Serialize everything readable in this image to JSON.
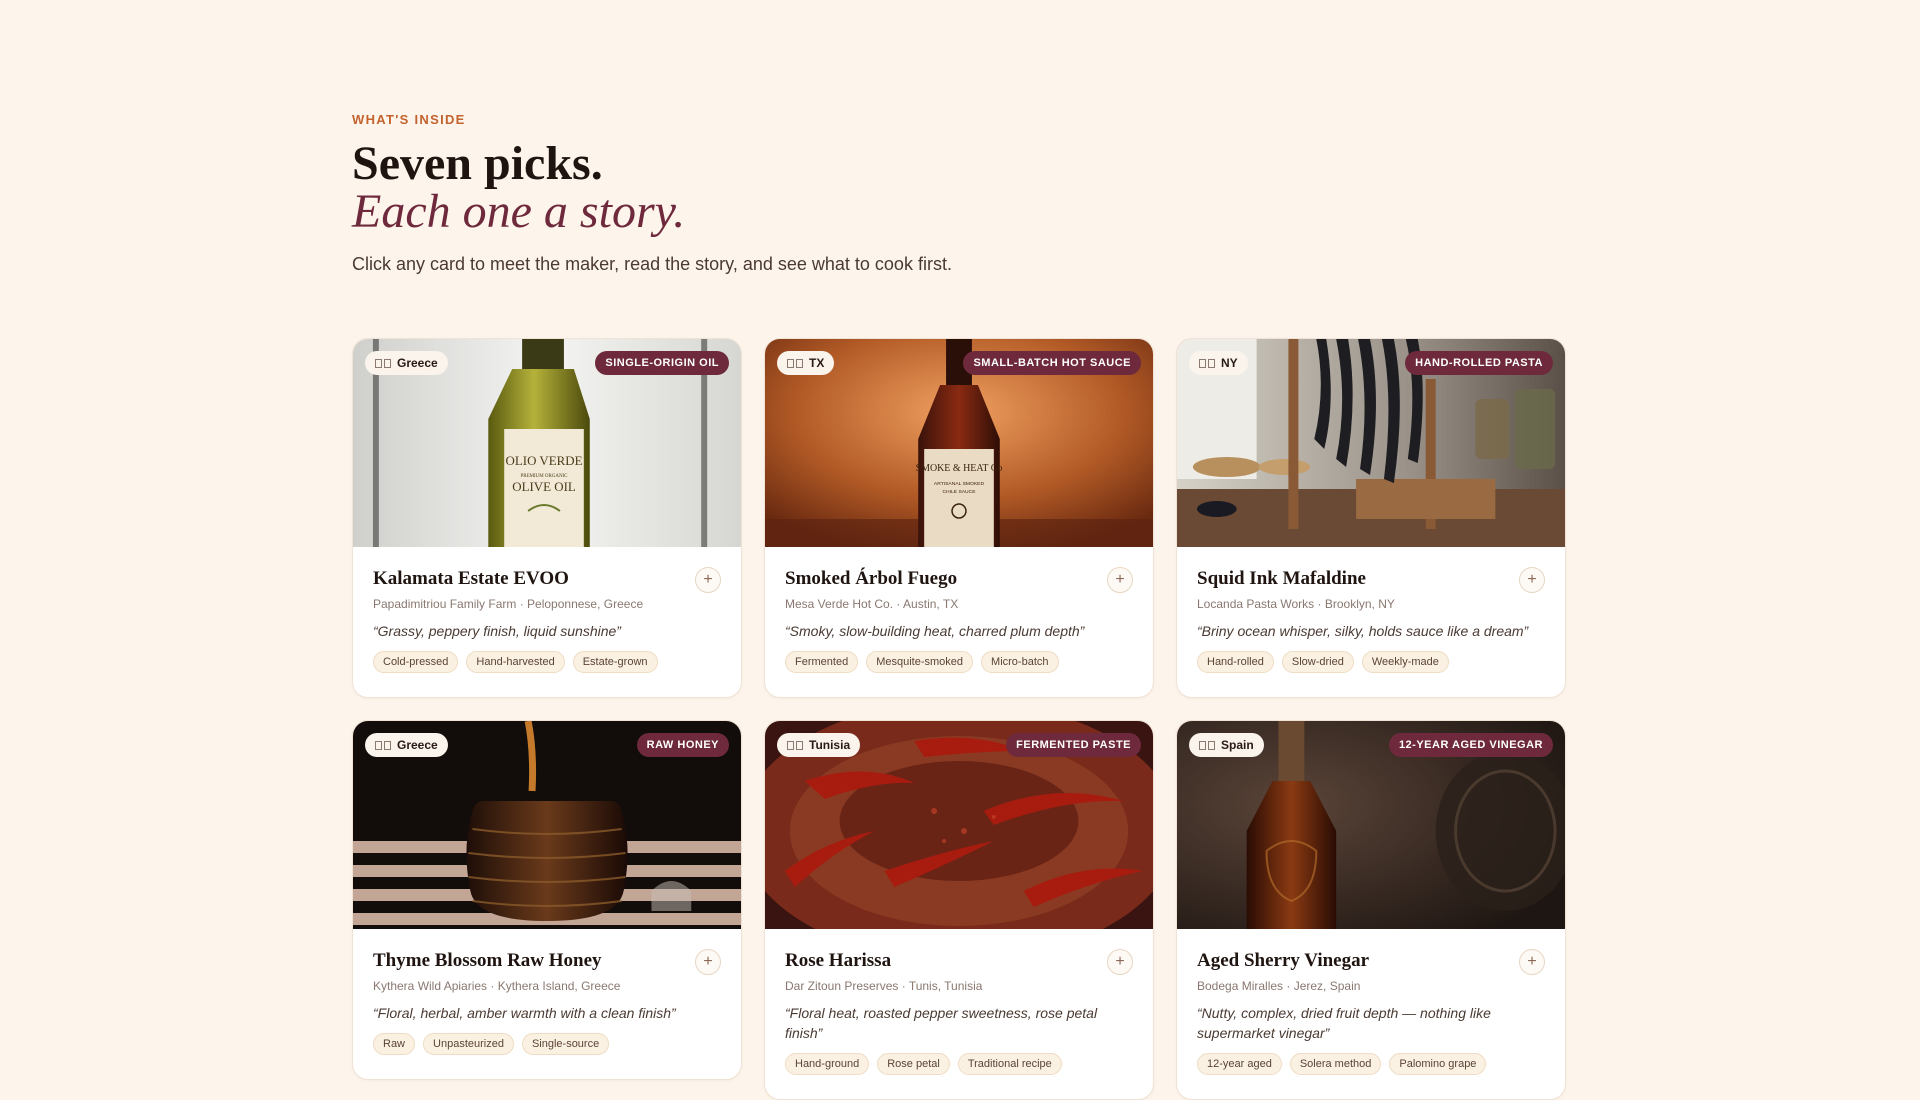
{
  "section": {
    "eyebrow": "WHAT'S INSIDE",
    "title_line1": "Seven picks.",
    "title_line2": "Each one a story.",
    "lede": "Click any card to meet the maker, read the story, and see what to cook first."
  },
  "colors": {
    "background": "#fdf5ec",
    "accent": "#c4622d",
    "brand_wine": "#6e2a3c"
  },
  "products": [
    {
      "origin": "Greece",
      "category": "SINGLE-ORIGIN OIL",
      "name": "Kalamata Estate EVOO",
      "maker": "Papadimitriou Family Farm · Peloponnese, Greece",
      "quote": "“Grassy, peppery finish, liquid sunshine”",
      "tags": [
        "Cold-pressed",
        "Hand-harvested",
        "Estate-grown"
      ],
      "image_label_1": "OLIO VERDE",
      "image_label_2": "PREMIUM ORGANIC",
      "image_label_3": "OLIVE OIL",
      "image_icon": "olive-oil-bottle-photo"
    },
    {
      "origin": "TX",
      "category": "SMALL-BATCH HOT SAUCE",
      "name": "Smoked Árbol Fuego",
      "maker": "Mesa Verde Hot Co. · Austin, TX",
      "quote": "“Smoky, slow-building heat, charred plum depth”",
      "tags": [
        "Fermented",
        "Mesquite-smoked",
        "Micro-batch"
      ],
      "image_label_1": "SMOKE & HEAT Co",
      "image_label_2": "ARTISANAL SMOKED",
      "image_label_3": "CHILE SAUCE",
      "image_icon": "hot-sauce-bottle-photo"
    },
    {
      "origin": "NY",
      "category": "HAND-ROLLED PASTA",
      "name": "Squid Ink Mafaldine",
      "maker": "Locanda Pasta Works · Brooklyn, NY",
      "quote": "“Briny ocean whisper, silky, holds sauce like a dream”",
      "tags": [
        "Hand-rolled",
        "Slow-dried",
        "Weekly-made"
      ],
      "image_icon": "pasta-drying-rack-photo"
    },
    {
      "origin": "Greece",
      "category": "RAW HONEY",
      "name": "Thyme Blossom Raw Honey",
      "maker": "Kythera Wild Apiaries · Kythera Island, Greece",
      "quote": "“Floral, herbal, amber warmth with a clean finish”",
      "tags": [
        "Raw",
        "Unpasteurized",
        "Single-source"
      ],
      "image_icon": "honey-jar-photo"
    },
    {
      "origin": "Tunisia",
      "category": "FERMENTED PASTE",
      "name": "Rose Harissa",
      "maker": "Dar Zitoun Preserves · Tunis, Tunisia",
      "quote": "“Floral heat, roasted pepper sweetness, rose petal finish”",
      "tags": [
        "Hand-ground",
        "Rose petal",
        "Traditional recipe"
      ],
      "image_icon": "harissa-bowl-photo"
    },
    {
      "origin": "Spain",
      "category": "12-YEAR AGED VINEGAR",
      "name": "Aged Sherry Vinegar",
      "maker": "Bodega Miralles · Jerez, Spain",
      "quote": "“Nutty, complex, dried fruit depth — nothing like supermarket vinegar”",
      "tags": [
        "12-year aged",
        "Solera method",
        "Palomino grape"
      ],
      "image_icon": "vinegar-bottle-photo"
    }
  ],
  "plus_glyph": "+"
}
